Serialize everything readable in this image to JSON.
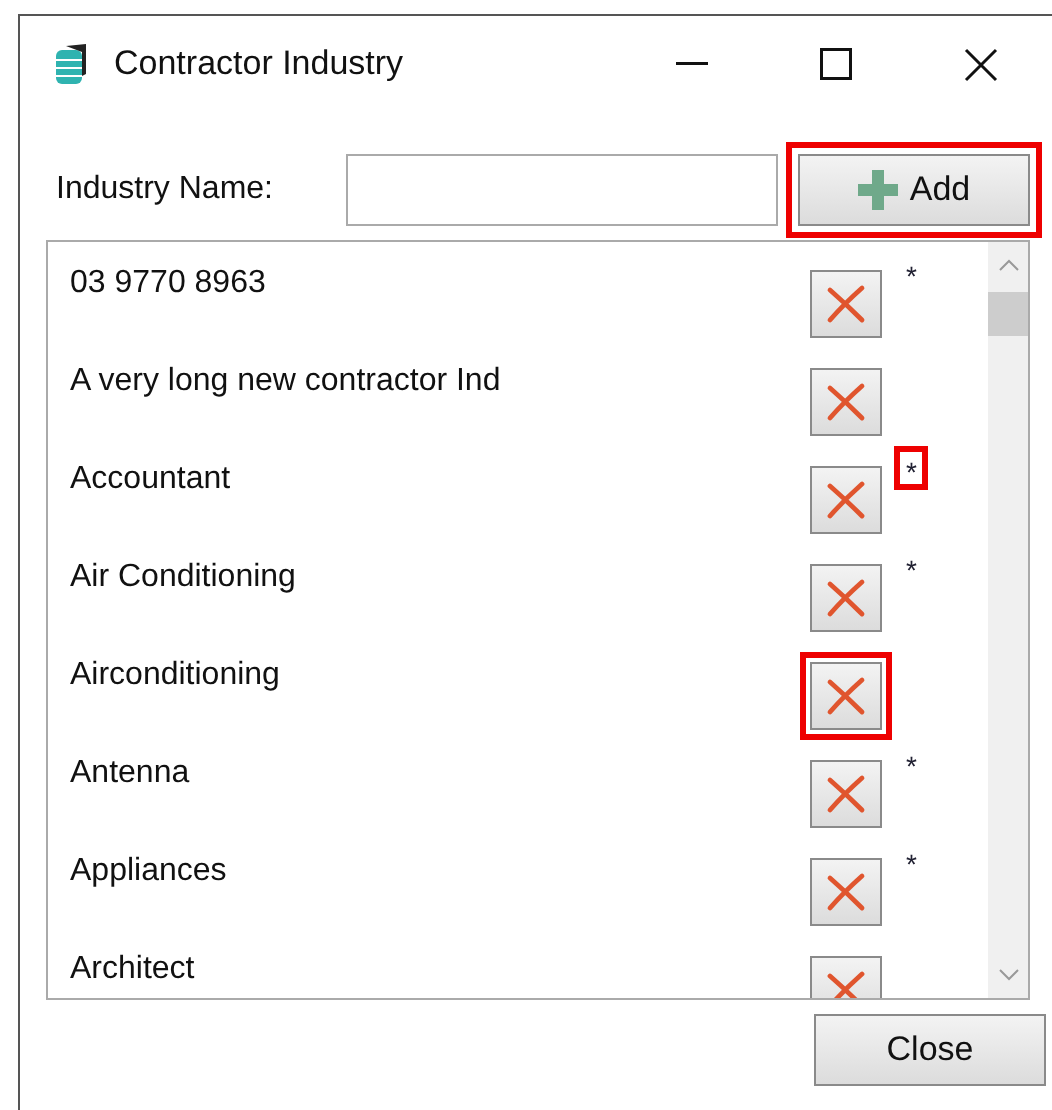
{
  "window": {
    "title": "Contractor Industry"
  },
  "industry_name": {
    "label": "Industry Name:"
  },
  "add_button": {
    "label": "Add",
    "highlighted": true
  },
  "industries": [
    {
      "name": "03 9770 8963",
      "starred": true,
      "star_highlighted": false,
      "delete_highlighted": false
    },
    {
      "name": "A very long new contractor Ind",
      "starred": false,
      "delete_highlighted": false
    },
    {
      "name": "Accountant",
      "starred": true,
      "star_highlighted": true,
      "delete_highlighted": false
    },
    {
      "name": "Air Conditioning",
      "starred": true,
      "star_highlighted": false,
      "delete_highlighted": false
    },
    {
      "name": "Airconditioning",
      "starred": false,
      "delete_highlighted": true
    },
    {
      "name": "Antenna",
      "starred": true,
      "star_highlighted": false,
      "delete_highlighted": false
    },
    {
      "name": "Appliances",
      "starred": true,
      "star_highlighted": false,
      "delete_highlighted": false
    },
    {
      "name": "Architect",
      "starred": false,
      "delete_highlighted": false
    }
  ],
  "star_mark": "*",
  "close_button": {
    "label": "Close"
  }
}
